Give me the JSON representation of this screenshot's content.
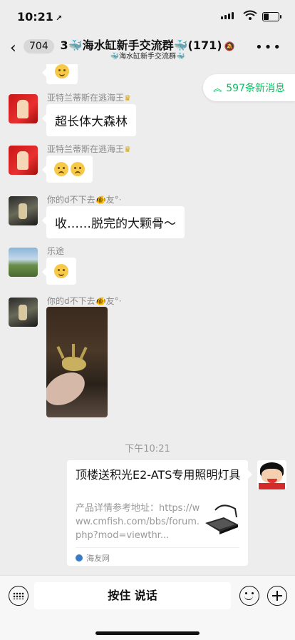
{
  "status": {
    "time": "10:21",
    "location_glyph": "↗"
  },
  "header": {
    "back_count": "704",
    "title_prefix": "3",
    "title_main": "海水缸新手交流群",
    "title_count": "(171)",
    "subtitle": "海水缸新手交流群",
    "more_label": "•••"
  },
  "new_messages": {
    "label": "597条新消息"
  },
  "messages": [
    {
      "sender": "亚特兰蒂斯在逃海王",
      "text": "超长体大森林"
    },
    {
      "sender": "亚特兰蒂斯在逃海王",
      "text": ""
    },
    {
      "sender": "你的d不下去",
      "sender_suffix": "友°·",
      "text": "收……脱完的大颗骨～"
    },
    {
      "sender": "乐途",
      "text": ""
    },
    {
      "sender": "你的d不下去",
      "sender_suffix": "友°·",
      "text": ""
    }
  ],
  "timestamp": "下午10:21",
  "link_card": {
    "title": "顶楼送积光E2-ATS专用照明灯具",
    "description": "产品详情参考地址：https://www.cmfish.com/bbs/forum.php?mod=viewthr...",
    "source": "海友网"
  },
  "input_bar": {
    "hold_to_talk": "按住 说话"
  },
  "colors": {
    "accent": "#07c160",
    "background": "#ededed",
    "bubble": "#ffffff"
  }
}
